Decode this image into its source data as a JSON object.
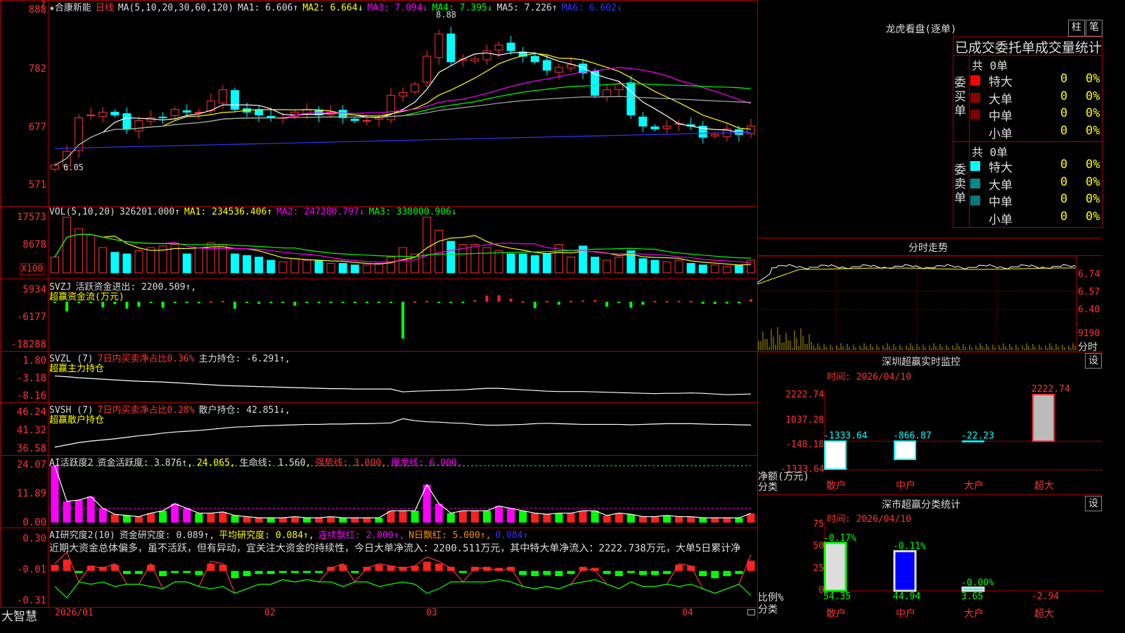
{
  "stock": {
    "name": "★合康新能",
    "period": "日线",
    "ma_label": "MA(5,10,20,30,60,120)",
    "ma1": "MA1: 6.606↑",
    "ma2": "MA2: 6.664↓",
    "ma3": "MA3: 7.094↓",
    "ma4": "MA4: 7.395↓",
    "ma5": "MA5: 7.226↑",
    "ma6": "MA6: 6.602↓",
    "high_mark": "8.88",
    "low_mark": "6.05",
    "question": "?"
  },
  "price_axis": [
    "888",
    "782",
    "677",
    "571"
  ],
  "vol": {
    "label": "VOL(5,10,20)",
    "value": "326201.000↑",
    "ma1": "MA1: 234536.406↑",
    "ma2": "MA2: 247280.797↓",
    "ma3": "MA3: 338000.906↓",
    "axis": [
      "17573",
      "8678"
    ],
    "unit": "X100"
  },
  "svzj": {
    "label": "SVZJ",
    "desc": "活跃资金进出: 2200.509↑,",
    "sub": "超赢资金流(万元)",
    "axis": [
      "5934",
      "-6177",
      "-18288"
    ]
  },
  "svzl": {
    "label": "SVZL (7)",
    "desc": "7日内买卖净占比0.36%",
    "main": "主力持仓: -6.291↑,",
    "sub": "超赢主力持仓",
    "axis": [
      "1.80",
      "-3.18",
      "-8.16"
    ]
  },
  "svsh": {
    "label": "SVSH (7)",
    "desc": "7日内买卖净占比0.28%",
    "main": "散户持仓: 42.851↓,",
    "sub": "超赢散户持仓",
    "axis": [
      "46.24",
      "41.32",
      "36.58"
    ]
  },
  "ai1": {
    "label": "AI活跃度2",
    "d1": "资金活跃度: 3.876↑,",
    "d2": "24.065,",
    "d3": "生命线: 1.560,",
    "d4": "强势线: 3.000,",
    "d5": "爆发线: 6.000,",
    "axis": [
      "24.07",
      "11.89",
      "0.00"
    ]
  },
  "ai2": {
    "label": "AI研究度2(10)",
    "d1": "资金研究度: 0.089↑,",
    "d2": "平均研究度: 0.084↑,",
    "d3": "连续飘红: 2.000↑,",
    "d4": "N日飘红: 5.000↑,",
    "d5": "0.084↑",
    "axis": [
      "0.30",
      "-0.01",
      "-0.31"
    ],
    "note": "近期大资金总体偏多，虽不活跃，但有异动，宜关注大资金的持续性，今日大单净流入：2200.511万元，其中特大单净流入：2222.738万元，大单5日累计净"
  },
  "xaxis": {
    "brand": "大智慧",
    "labels": [
      "2026/01",
      "02",
      "03",
      "04"
    ]
  },
  "right": {
    "lh_title": "龙虎看盘(逐单)",
    "btn_zhu": "柱",
    "btn_bi": "笔",
    "table_title": "已成交委托单成交量统计",
    "buy": {
      "side": "委买单",
      "total": "共 0单",
      "rows": [
        {
          "name": "特大",
          "v": "0",
          "p": "0%",
          "c": "#ff0000"
        },
        {
          "name": "大单",
          "v": "0",
          "p": "0%",
          "c": "#8b0000"
        },
        {
          "name": "中单",
          "v": "0",
          "p": "0%",
          "c": "#7a0000"
        },
        {
          "name": "小单",
          "v": "0",
          "p": "0%",
          "c": "#000000"
        }
      ]
    },
    "sell": {
      "side": "委卖单",
      "total": "共 0单",
      "rows": [
        {
          "name": "特大",
          "v": "0",
          "p": "0%",
          "c": "#00ffff"
        },
        {
          "name": "大单",
          "v": "0",
          "p": "0%",
          "c": "#008b8b"
        },
        {
          "name": "中单",
          "v": "0",
          "p": "0%",
          "c": "#007a7a"
        },
        {
          "name": "小单",
          "v": "0",
          "p": "0%",
          "c": "#000000"
        }
      ]
    },
    "fs_title": "分时走势",
    "fs_axis": [
      "6.74",
      "6.57",
      "6.40",
      "9190"
    ],
    "fs_unit": "分时",
    "sz_title": "深圳超赢实时监控",
    "sz_btn": "设",
    "sz_time": "时间: 2026/04/10",
    "sz_axis": [
      "2222.74",
      "1037.28",
      "-148.18",
      "-1333.64"
    ],
    "sz_ylabel": "净额(万元)",
    "sz_xlabel": "分类",
    "sz_bars": [
      {
        "cat": "散户",
        "v": -1333.64,
        "label": "-1333.64"
      },
      {
        "cat": "中户",
        "v": -866.87,
        "label": "-866.87"
      },
      {
        "cat": "大户",
        "v": -22.23,
        "label": "-22.23"
      },
      {
        "cat": "超大",
        "v": 2222.74,
        "label": "2222.74"
      }
    ],
    "ss_title": "深市超赢分类统计",
    "ss_btn": "设",
    "ss_time": "时间: 2026/04/10",
    "ss_axis": [
      "75",
      "50",
      "25",
      "0"
    ],
    "ss_ylabel": "比例%",
    "ss_xlabel": "分类",
    "ss_bars": [
      {
        "cat": "散户",
        "v": 54.35,
        "top": "-0.17%",
        "bottom": "54.35"
      },
      {
        "cat": "中户",
        "v": 44.94,
        "top": "-0.11%",
        "bottom": "44.94"
      },
      {
        "cat": "大户",
        "v": 3.65,
        "top": "-0.00%",
        "bottom": "3.65"
      },
      {
        "cat": "超大",
        "v": -2.94,
        "top": "",
        "bottom": "-2.94"
      }
    ]
  },
  "chart_data": [
    {
      "type": "candlestick",
      "title": "合康新能 日线",
      "ylim": [
        5.71,
        8.88
      ],
      "close": [
        6.05,
        6.3,
        6.9,
        6.95,
        7.0,
        6.95,
        6.7,
        6.85,
        6.9,
        6.9,
        7.05,
        7.0,
        7.0,
        7.2,
        7.4,
        7.05,
        7.0,
        6.95,
        6.9,
        6.9,
        7.0,
        7.05,
        6.95,
        7.0,
        6.9,
        6.85,
        6.85,
        6.9,
        7.3,
        7.35,
        7.5,
        8.0,
        8.4,
        7.9,
        7.95,
        7.95,
        8.1,
        8.2,
        8.1,
        8.0,
        7.9,
        7.75,
        7.8,
        7.85,
        7.7,
        7.3,
        7.4,
        7.5,
        6.95,
        6.75,
        6.7,
        6.75,
        6.8,
        6.75,
        6.55,
        6.6,
        6.7,
        6.6,
        6.75
      ],
      "volume": [
        5000,
        17573,
        14000,
        12000,
        8000,
        6500,
        6000,
        7000,
        8000,
        8500,
        9000,
        6000,
        8000,
        9500,
        9000,
        6000,
        5500,
        5000,
        4000,
        3500,
        4500,
        4000,
        4000,
        3000,
        3000,
        2500,
        2500,
        3000,
        5000,
        8000,
        6000,
        17573,
        13500,
        10000,
        9000,
        9000,
        8000,
        7000,
        6000,
        6000,
        5500,
        6000,
        9000,
        5000,
        8500,
        5000,
        4000,
        5000,
        7000,
        4500,
        4000,
        3500,
        4000,
        3000,
        2500,
        2500,
        2000,
        2500,
        4000
      ],
      "svzj": [
        -300,
        -4800,
        -400,
        -600,
        -2800,
        -1200,
        -3400,
        -2500,
        -200,
        -3000,
        -400,
        -600,
        -800,
        200,
        400,
        -3500,
        -200,
        -1000,
        -400,
        -300,
        -2000,
        -400,
        -400,
        -300,
        -600,
        -400,
        -200,
        -200,
        -300,
        -18288,
        200,
        400,
        -300,
        -400,
        -200,
        700,
        3000,
        3200,
        1500,
        200,
        -3200,
        400,
        -1500,
        400,
        600,
        800,
        -2500,
        -300,
        -3000,
        -1500,
        400,
        400,
        400,
        400,
        -1000,
        -1100,
        -900,
        -800,
        1200
      ],
      "svzl": [
        -2.5,
        -2.7,
        -3.0,
        -3.2,
        -3.4,
        -3.6,
        -3.8,
        -4.0,
        -4.1,
        -4.2,
        -4.4,
        -4.6,
        -4.8,
        -5.0,
        -5.2,
        -5.3,
        -5.4,
        -5.5,
        -5.6,
        -5.7,
        -5.8,
        -5.9,
        -6.0,
        -6.1,
        -6.1,
        -6.2,
        -6.2,
        -6.2,
        -6.2,
        -7.0,
        -6.8,
        -6.7,
        -6.6,
        -6.5,
        -6.4,
        -6.2,
        -6.0,
        -6.0,
        -6.2,
        -6.4,
        -6.6,
        -6.8,
        -6.9,
        -6.9,
        -6.9,
        -7.0,
        -7.1,
        -7.2,
        -7.3,
        -7.4,
        -7.5,
        -7.4,
        -7.4,
        -7.3,
        -7.4,
        -7.6,
        -7.8,
        -7.7,
        -7.6
      ],
      "svsh": [
        37.0,
        37.6,
        38.2,
        38.6,
        38.9,
        39.2,
        39.6,
        40.0,
        40.3,
        40.7,
        41.0,
        41.2,
        41.4,
        41.7,
        42.0,
        42.3,
        42.4,
        42.6,
        42.7,
        42.8,
        42.9,
        43.0,
        43.0,
        43.1,
        43.1,
        43.2,
        43.2,
        43.3,
        43.4,
        44.5,
        44.0,
        43.7,
        43.6,
        43.4,
        43.3,
        43.0,
        42.8,
        42.8,
        42.9,
        43.0,
        43.2,
        43.3,
        43.2,
        43.1,
        43.0,
        43.0,
        43.0,
        43.0,
        42.9,
        43.0,
        43.1,
        43.2,
        43.2,
        43.2,
        43.1,
        43.0,
        43.0,
        42.9,
        42.85
      ],
      "ai_activity": [
        24.07,
        9.0,
        9.5,
        11.0,
        6.0,
        3.5,
        3.0,
        2.5,
        4.0,
        5.0,
        8.0,
        6.0,
        4.0,
        4.0,
        4.5,
        3.0,
        2.5,
        2.0,
        2.0,
        2.0,
        2.5,
        2.0,
        2.0,
        2.5,
        2.0,
        2.0,
        2.0,
        2.0,
        5.0,
        5.0,
        5.0,
        16.0,
        8.0,
        4.0,
        5.0,
        5.0,
        5.0,
        7.0,
        6.0,
        5.0,
        4.0,
        3.5,
        4.0,
        4.0,
        5.0,
        5.0,
        3.0,
        4.0,
        3.5,
        2.5,
        2.5,
        3.0,
        2.5,
        2.5,
        2.0,
        2.0,
        2.0,
        2.0,
        3.876
      ],
      "ai_research": [
        0.05,
        0.1,
        -0.03,
        0.04,
        0.03,
        0.05,
        -0.04,
        -0.04,
        0.05,
        -0.06,
        -0.03,
        -0.03,
        -0.05,
        0.06,
        0.05,
        -0.08,
        -0.06,
        -0.04,
        -0.04,
        -0.02,
        -0.03,
        -0.02,
        -0.03,
        0.03,
        0.05,
        -0.03,
        0.03,
        0.05,
        0.04,
        0.03,
        0.04,
        0.08,
        0.06,
        0.03,
        -0.03,
        0.03,
        0.03,
        0.02,
        0.03,
        -0.05,
        -0.06,
        -0.05,
        -0.06,
        -0.04,
        0.03,
        0.02,
        -0.04,
        -0.06,
        -0.03,
        -0.05,
        -0.05,
        -0.04,
        0.05,
        0.04,
        -0.06,
        -0.08,
        -0.06,
        -0.04,
        0.089
      ]
    }
  ],
  "colors": {
    "up": "#ff3333",
    "down": "#00ffff",
    "border": "#aa0000",
    "grid_red": "#aa0000"
  }
}
